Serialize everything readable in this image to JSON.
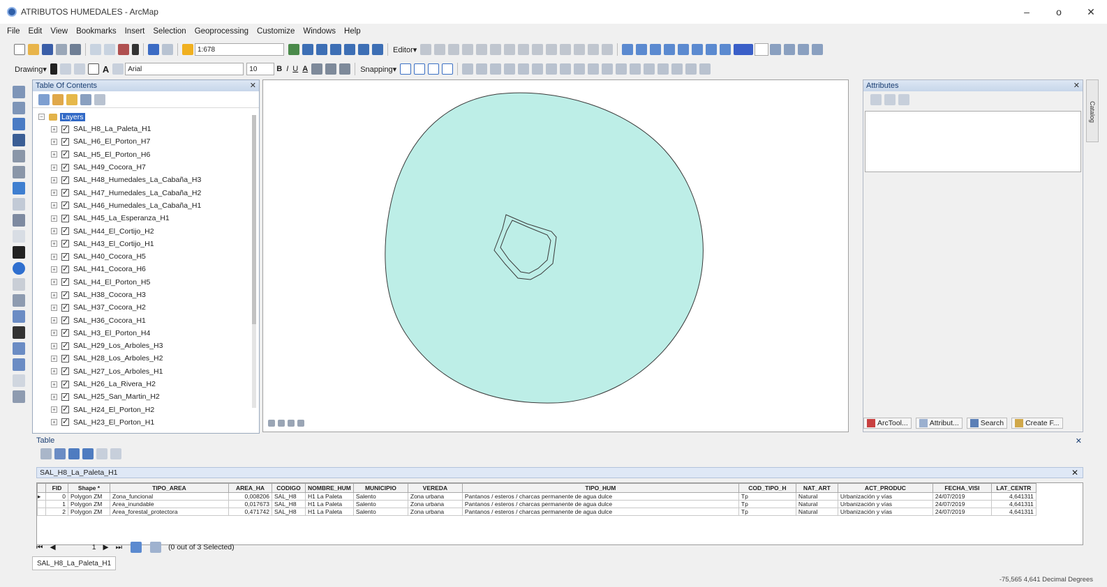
{
  "window": {
    "title": "ATRIBUTOS HUMEDALES - ArcMap",
    "minimize": "–",
    "maximize": "o",
    "close": "✕"
  },
  "menu": [
    "File",
    "Edit",
    "View",
    "Bookmarks",
    "Insert",
    "Selection",
    "Geoprocessing",
    "Customize",
    "Windows",
    "Help"
  ],
  "toolbar": {
    "scale": "1:678",
    "editor_label": "Editor▾",
    "drawing_label": "Drawing▾",
    "font_name": "Arial",
    "font_size": "10",
    "snapping_label": "Snapping▾",
    "bold": "B",
    "italic": "I",
    "underline": "U",
    "font_color": "A"
  },
  "toc": {
    "title": "Table Of Contents",
    "pin": "✕",
    "root_label": "Layers",
    "layers": [
      "SAL_H8_La_Paleta_H1",
      "SAL_H6_El_Porton_H7",
      "SAL_H5_El_Porton_H6",
      "SAL_H49_Cocora_H7",
      "SAL_H48_Humedales_La_Cabaña_H3",
      "SAL_H47_Humedales_La_Cabaña_H2",
      "SAL_H46_Humedales_La_Cabaña_H1",
      "SAL_H45_La_Esperanza_H1",
      "SAL_H44_El_Cortijo_H2",
      "SAL_H43_El_Cortijo_H1",
      "SAL_H40_Cocora_H5",
      "SAL_H41_Cocora_H6",
      "SAL_H4_El_Porton_H5",
      "SAL_H38_Cocora_H3",
      "SAL_H37_Cocora_H2",
      "SAL_H36_Cocora_H1",
      "SAL_H3_El_Porton_H4",
      "SAL_H29_Los_Arboles_H3",
      "SAL_H28_Los_Arboles_H2",
      "SAL_H27_Los_Arboles_H1",
      "SAL_H26_La_Rivera_H2",
      "SAL_H25_San_Martin_H2",
      "SAL_H24_El_Porton_H2",
      "SAL_H23_El_Porton_H1"
    ]
  },
  "attributes": {
    "title": "Attributes",
    "pin": "✕",
    "tabs": [
      "ArcTool...",
      "Attribut...",
      "Search",
      "Create F..."
    ],
    "catalog": "Catalog"
  },
  "table": {
    "panel_title": "Table",
    "pin": "✕",
    "layer_tab": "SAL_H8_La_Paleta_H1",
    "close": "✕",
    "columns": [
      "FID",
      "Shape *",
      "TIPO_AREA",
      "AREA_HA",
      "CODIGO",
      "NOMBRE_HUM",
      "MUNICIPIO",
      "VEREDA",
      "TIPO_HUM",
      "COD_TIPO_H",
      "NAT_ART",
      "ACT_PRODUC",
      "FECHA_VISI",
      "LAT_CENTR"
    ],
    "rows": [
      [
        "0",
        "Polygon ZM",
        "Zona_funcional",
        "0,008206",
        "SAL_H8",
        "H1 La Paleta",
        "Salento",
        "Zona urbana",
        "Pantanos / esteros / charcas permanente de agua dulce",
        "Tp",
        "Natural",
        "Urbanización y vías",
        "24/07/2019",
        "4,641311"
      ],
      [
        "1",
        "Polygon ZM",
        "Area_inundable",
        "0,017673",
        "SAL_H8",
        "H1 La Paleta",
        "Salento",
        "Zona urbana",
        "Pantanos / esteros / charcas permanente de agua dulce",
        "Tp",
        "Natural",
        "Urbanización y vías",
        "24/07/2019",
        "4,641311"
      ],
      [
        "2",
        "Polygon ZM",
        "Area_forestal_protectora",
        "0,471742",
        "SAL_H8",
        "H1 La Paleta",
        "Salento",
        "Zona urbana",
        "Pantanos / esteros / charcas permanente de agua dulce",
        "Tp",
        "Natural",
        "Urbanización y vías",
        "24/07/2019",
        "4,641311"
      ]
    ],
    "record_number": "1",
    "selection_text": "(0 out of 3 Selected)",
    "bottom_tab": "SAL_H8_La_Paleta_H1"
  },
  "status": {
    "coordinates": "-75,565  4,641 Decimal Degrees"
  },
  "colors": {
    "polygon_fill": "#bdeee7",
    "polygon_stroke": "#3a3a3a",
    "selected_layer": "#3169c6"
  }
}
